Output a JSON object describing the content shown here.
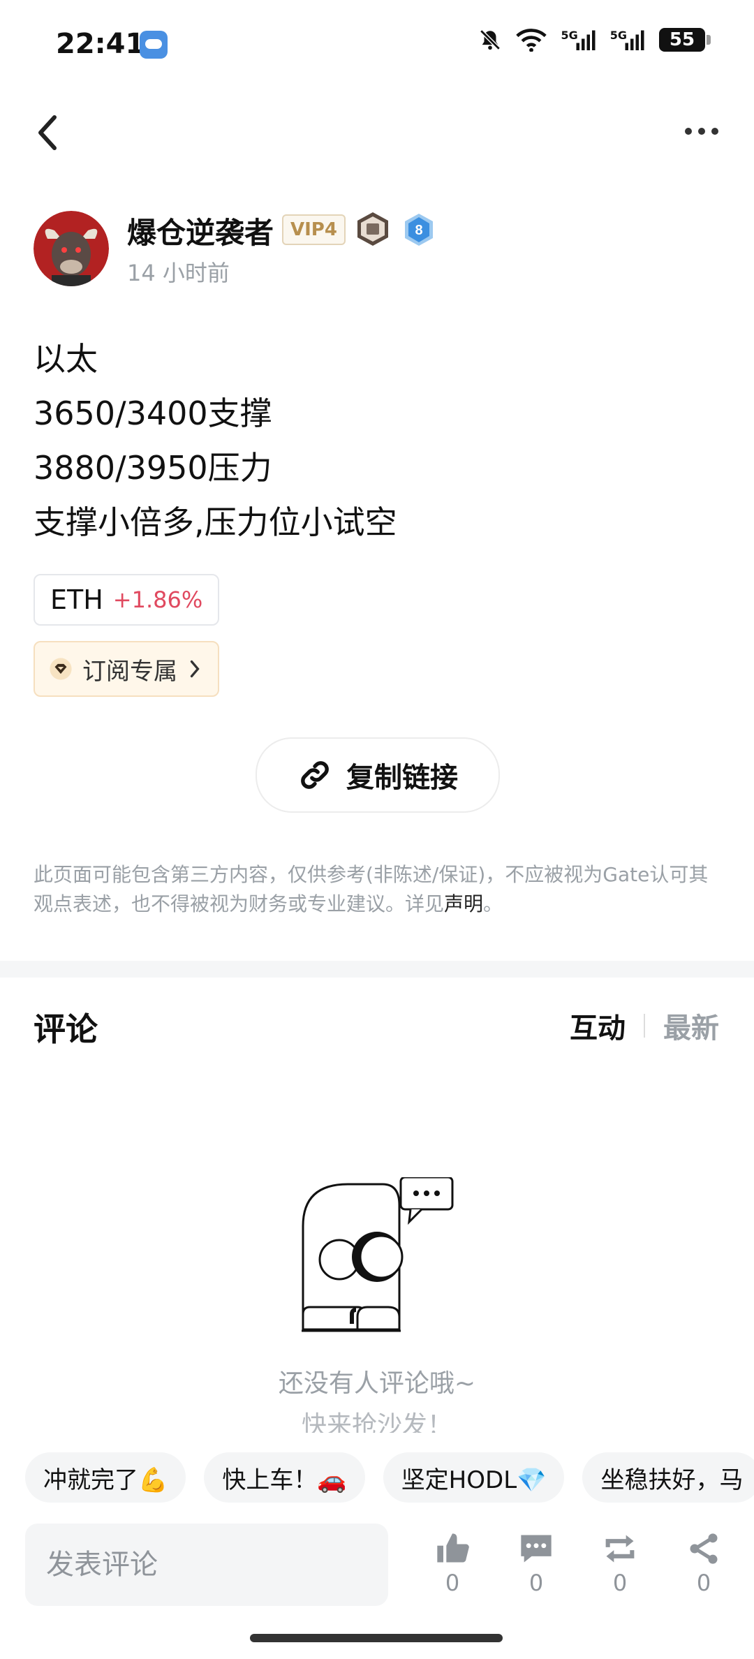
{
  "status_bar": {
    "time": "22:41",
    "signal1": "5G",
    "signal2": "5G",
    "battery": "55"
  },
  "author": {
    "name": "爆仓逆袭者",
    "vip": "VIP4",
    "rank": "8",
    "time_ago": "14 小时前"
  },
  "post": {
    "lines": [
      "以太",
      "3650/3400支撑",
      "3880/3950压力",
      "支撑小倍多,压力位小试空"
    ]
  },
  "ticker": {
    "symbol": "ETH",
    "change": "+1.86%"
  },
  "subscription": {
    "label": "订阅专属"
  },
  "copy_link": {
    "label": "复制链接"
  },
  "disclaimer": {
    "text_1": "此页面可能包含第三方内容，仅供参考(非陈述/保证)，不应被视为Gate认可其观点表述，也不得被视为财务或专业建议。详见",
    "link": "声明",
    "text_2": "。"
  },
  "comments": {
    "title": "评论",
    "sort_active": "互动",
    "sort_inactive": "最新",
    "empty_line1": "还没有人评论哦~",
    "empty_line2": "快来抢沙发！"
  },
  "quick_replies": [
    "冲就完了💪",
    "快上车！🚗",
    "坚定HODL💎",
    "坐稳扶好，马"
  ],
  "bottom_bar": {
    "input_placeholder": "发表评论",
    "like_count": "0",
    "comment_count": "0",
    "repost_count": "0",
    "share_count": "0"
  },
  "colors": {
    "positive_change": "#e0495f",
    "vip_gold": "#b78f4e",
    "muted_text": "#9aa0a6"
  }
}
